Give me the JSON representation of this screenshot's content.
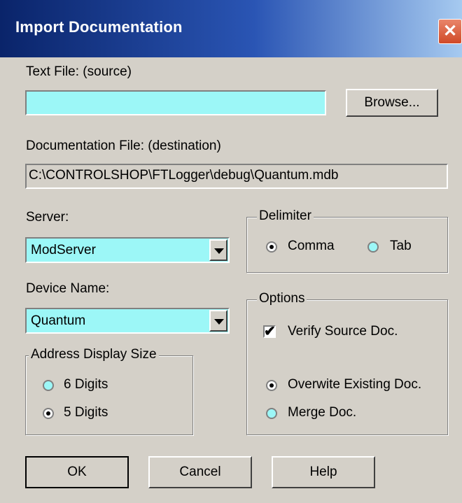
{
  "window": {
    "title": "Import Documentation",
    "close_glyph": "✕"
  },
  "text_file": {
    "label": "Text File: (source)",
    "value": "",
    "browse_label": "Browse..."
  },
  "doc_file": {
    "label": "Documentation File: (destination)",
    "value": "C:\\CONTROLSHOP\\FTLogger\\debug\\Quantum.mdb"
  },
  "server": {
    "label": "Server:",
    "value": "ModServer"
  },
  "device": {
    "label": "Device Name:",
    "value": "Quantum"
  },
  "delimiter": {
    "title": "Delimiter",
    "options": [
      {
        "label": "Comma",
        "selected": true
      },
      {
        "label": "Tab",
        "selected": false
      }
    ]
  },
  "address": {
    "title": "Address Display Size",
    "options": [
      {
        "label": "6 Digits",
        "selected": false
      },
      {
        "label": "5 Digits",
        "selected": true
      }
    ]
  },
  "options": {
    "title": "Options",
    "verify_label": "Verify Source Doc.",
    "verify_checked": true,
    "modes": [
      {
        "label": "Overwite Existing Doc.",
        "selected": true
      },
      {
        "label": "Merge Doc.",
        "selected": false
      }
    ]
  },
  "buttons": {
    "ok": "OK",
    "cancel": "Cancel",
    "help": "Help"
  },
  "colors": {
    "field": "#9cf7f7",
    "dialog": "#d4d0c8",
    "titlebar": "#0a246a"
  }
}
